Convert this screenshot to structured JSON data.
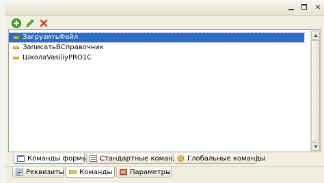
{
  "window": {
    "controls": [
      "minimize-icon",
      "maximize-icon",
      "close-icon"
    ]
  },
  "toolbar": {
    "buttons": [
      {
        "icon": "add-icon",
        "color": "#3a9a2a"
      },
      {
        "icon": "edit-icon",
        "color": "#2f8f1f"
      },
      {
        "icon": "delete-icon",
        "color": "#d23a1a"
      }
    ]
  },
  "commands": {
    "items": [
      {
        "label": "ЗагрузитьФайл",
        "selected": true
      },
      {
        "label": "ЗаписатьВСправочник",
        "selected": false
      },
      {
        "label": "ШколаVasiliyPRO1C",
        "selected": false
      }
    ],
    "selection_color": "#316ac5"
  },
  "command_tabs": [
    {
      "label": "Команды формы",
      "active": true
    },
    {
      "label": "Стандартные команды",
      "active": false
    },
    {
      "label": "Глобальные команды",
      "active": false
    }
  ],
  "bottom_tabs": [
    {
      "label": "Реквизиты",
      "active": false
    },
    {
      "label": "Команды",
      "active": true
    },
    {
      "label": "Параметры",
      "active": false
    }
  ]
}
